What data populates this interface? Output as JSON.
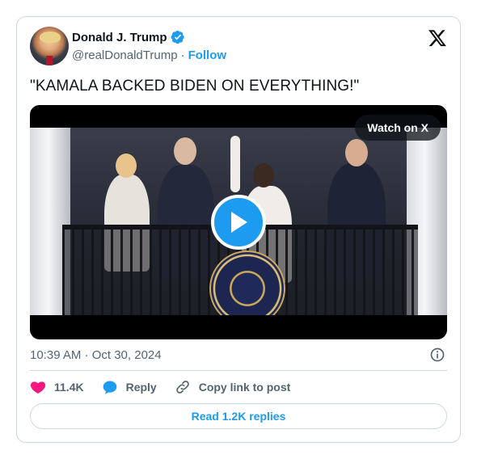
{
  "author": {
    "name": "Donald J. Trump",
    "handle": "@realDonaldTrump",
    "separator": "·",
    "follow_label": "Follow"
  },
  "tweet": {
    "text": "\"KAMALA BACKED BIDEN ON EVERYTHING!\"",
    "timestamp": "10:39 AM · Oct 30, 2024"
  },
  "media": {
    "watch_label": "Watch on X"
  },
  "actions": {
    "likes": "11.4K",
    "reply_label": "Reply",
    "copy_label": "Copy link to post"
  },
  "footer": {
    "replies_label": "Read 1.2K replies"
  },
  "colors": {
    "accent": "#1d9bf0",
    "like": "#f91880",
    "text": "#0f1419",
    "muted": "#536471",
    "border": "#cfd9de"
  },
  "icons": [
    "verified-badge-icon",
    "x-logo-icon",
    "play-icon",
    "info-icon",
    "heart-icon",
    "reply-bubble-icon",
    "link-icon"
  ]
}
